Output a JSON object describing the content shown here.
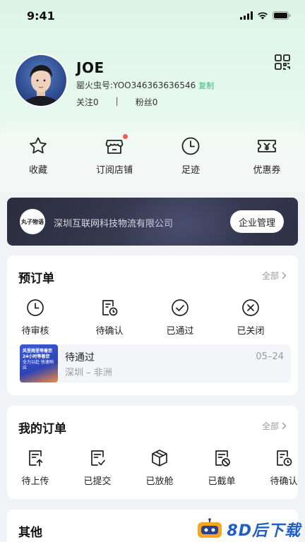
{
  "status_bar": {
    "time": "9:41"
  },
  "profile": {
    "name": "JOE",
    "id_label": "罂火虫号:YOO346363636546",
    "copy_label": "复制",
    "follow_label": "关注0",
    "stats_separator": "|",
    "fans_label": "粉丝0"
  },
  "quick_actions": [
    {
      "label": "收藏",
      "icon": "star-icon"
    },
    {
      "label": "订阅店铺",
      "icon": "store-icon"
    },
    {
      "label": "足迹",
      "icon": "clock-icon"
    },
    {
      "label": "优惠券",
      "icon": "coupon-icon"
    }
  ],
  "company": {
    "logo_text": "丸子物语",
    "name": "深圳互联网科技物流有限公司",
    "manage_label": "企业管理"
  },
  "preorder": {
    "title": "预订单",
    "more_label": "全部",
    "statuses": [
      {
        "label": "待审核",
        "icon": "clock-icon"
      },
      {
        "label": "待确认",
        "icon": "document-clock-icon"
      },
      {
        "label": "已通过",
        "icon": "check-circle-icon"
      },
      {
        "label": "已关闭",
        "icon": "close-circle-icon"
      }
    ],
    "item": {
      "thumb_line1": "风里雨里等着您",
      "thumb_line2": "24小时等着您",
      "thumb_line3": "全力以赴 快速响应",
      "status": "待通过",
      "route": "深圳 – 非洲",
      "date": "05–24"
    }
  },
  "my_orders": {
    "title": "我的订单",
    "more_label": "全部",
    "statuses": [
      {
        "label": "待上传",
        "icon": "document-upload-icon"
      },
      {
        "label": "已提交",
        "icon": "document-check-icon"
      },
      {
        "label": "已放舱",
        "icon": "box-icon"
      },
      {
        "label": "已截单",
        "icon": "document-block-icon"
      },
      {
        "label": "待确认",
        "icon": "document-clock-icon"
      }
    ]
  },
  "other": {
    "title": "其他"
  },
  "watermark": {
    "text": "8D后下载"
  },
  "colors": {
    "accent_green": "#2fbf77",
    "badge_red": "#f15b50",
    "company_bg": "#2b2d3e"
  }
}
